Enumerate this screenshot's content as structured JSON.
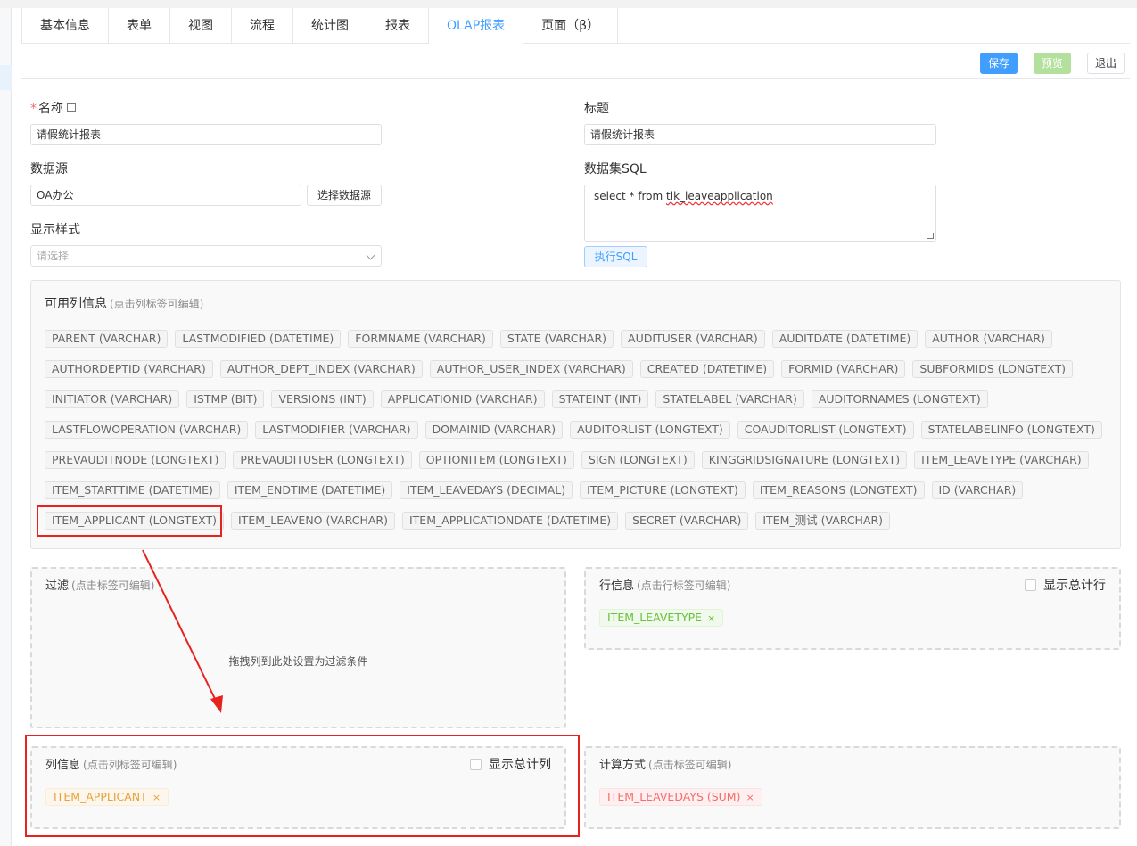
{
  "tabs": [
    "基本信息",
    "表单",
    "视图",
    "流程",
    "统计图",
    "报表",
    "OLAP报表",
    "页面（β）"
  ],
  "active_tab": "OLAP报表",
  "toolbar": {
    "save": "保存",
    "preview": "预览",
    "exit": "退出"
  },
  "form": {
    "name_label": "名称",
    "name_value": "请假统计报表",
    "title_label": "标题",
    "title_value": "请假统计报表",
    "datasource_label": "数据源",
    "datasource_value": "OA办公",
    "choose_datasource": "选择数据源",
    "sql_label": "数据集SQL",
    "sql_prefix": "select * from ",
    "sql_table": "tlk_leaveapplication",
    "run_sql": "执行SQL",
    "style_label": "显示样式",
    "style_placeholder": "请选择"
  },
  "columns_panel": {
    "title": "可用列信息",
    "hint": "(点击列标签可编辑)",
    "rows": [
      [
        "PARENT (VARCHAR)",
        "LASTMODIFIED (DATETIME)",
        "FORMNAME (VARCHAR)",
        "STATE (VARCHAR)",
        "AUDITUSER (VARCHAR)",
        "AUDITDATE (DATETIME)",
        "AUTHOR (VARCHAR)"
      ],
      [
        "AUTHORDEPTID (VARCHAR)",
        "AUTHOR_DEPT_INDEX (VARCHAR)",
        "AUTHOR_USER_INDEX (VARCHAR)",
        "CREATED (DATETIME)",
        "FORMID (VARCHAR)",
        "SUBFORMIDS (LONGTEXT)"
      ],
      [
        "INITIATOR (VARCHAR)",
        "ISTMP (BIT)",
        "VERSIONS (INT)",
        "APPLICATIONID (VARCHAR)",
        "STATEINT (INT)",
        "STATELABEL (VARCHAR)",
        "AUDITORNAMES (LONGTEXT)"
      ],
      [
        "LASTFLOWOPERATION (VARCHAR)",
        "LASTMODIFIER (VARCHAR)",
        "DOMAINID (VARCHAR)",
        "AUDITORLIST (LONGTEXT)",
        "COAUDITORLIST (LONGTEXT)",
        "STATELABELINFO (LONGTEXT)"
      ],
      [
        "PREVAUDITNODE (LONGTEXT)",
        "PREVAUDITUSER (LONGTEXT)",
        "OPTIONITEM (LONGTEXT)",
        "SIGN (LONGTEXT)",
        "KINGGRIDSIGNATURE (LONGTEXT)",
        "ITEM_LEAVETYPE (VARCHAR)"
      ],
      [
        "ITEM_STARTTIME (DATETIME)",
        "ITEM_ENDTIME (DATETIME)",
        "ITEM_LEAVEDAYS (DECIMAL)",
        "ITEM_PICTURE (LONGTEXT)",
        "ITEM_REASONS (LONGTEXT)",
        "ID (VARCHAR)"
      ],
      [
        "ITEM_APPLICANT (LONGTEXT)",
        "ITEM_LEAVENO (VARCHAR)",
        "ITEM_APPLICATIONDATE (DATETIME)",
        "SECRET (VARCHAR)",
        "ITEM_测试 (VARCHAR)"
      ]
    ]
  },
  "filter": {
    "title": "过滤",
    "hint": "(点击标签可编辑)",
    "placeholder": "拖拽列到此处设置为过滤条件"
  },
  "row_info": {
    "title": "行信息",
    "hint": "(点击行标签可编辑)",
    "checkbox": "显示总计行",
    "chip": "ITEM_LEAVETYPE"
  },
  "col_info": {
    "title": "列信息",
    "hint": "(点击列标签可编辑)",
    "checkbox": "显示总计列",
    "chip": "ITEM_APPLICANT"
  },
  "calc": {
    "title": "计算方式",
    "hint": "(点击标签可编辑)",
    "chip": "ITEM_LEAVEDAYS (SUM)"
  },
  "colors": {
    "accent": "#409eff",
    "annotation": "#e8231f"
  }
}
